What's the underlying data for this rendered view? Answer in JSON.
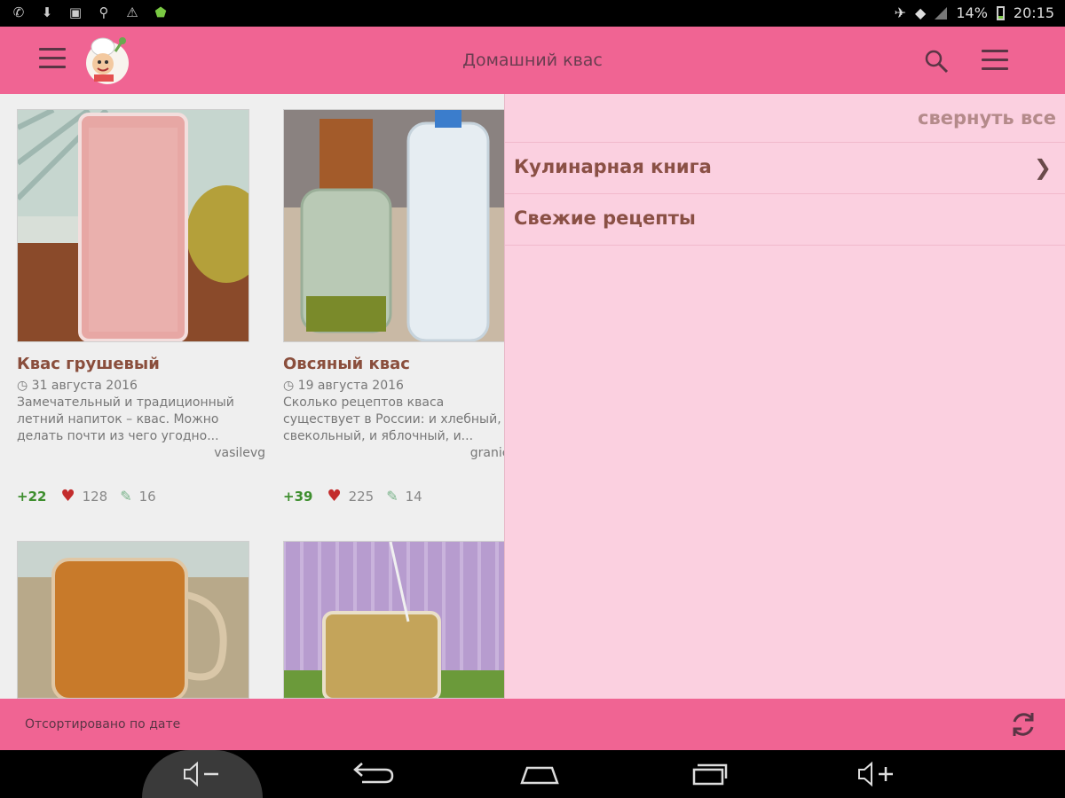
{
  "status_bar": {
    "left_icons": [
      "whatsapp-icon",
      "download-icon",
      "image-icon",
      "search-icon",
      "warning-icon",
      "shield-icon"
    ],
    "battery": "14%",
    "time": "20:15"
  },
  "app_bar": {
    "title": "Домашний квас",
    "colors": {
      "accent": "#f06493",
      "drawer": "#fbd0e0"
    }
  },
  "recipes": [
    {
      "title": "Квас грушевый",
      "date": "31 августа 2016",
      "description": "Замечательный и традиционный летний напиток – квас. Можно делать почти из чего угодно...",
      "author": "vasilevg",
      "score": "+22",
      "likes": "128",
      "comments": "16"
    },
    {
      "title": "Овсяный квас",
      "date": "19 августа 2016",
      "description": "Сколько рецептов кваса существует в России: и хлебный, и свекольный, и яблочный, и...",
      "author": "granichnil",
      "score": "+39",
      "likes": "225",
      "comments": "14"
    }
  ],
  "drawer": {
    "collapse_all": "свернуть все",
    "items": [
      {
        "label": "Кулинарная книга",
        "has_arrow": true
      },
      {
        "label": "Свежие рецепты",
        "has_arrow": false
      }
    ]
  },
  "bottom_bar": {
    "sort_label": "Отсортировано по дате"
  },
  "nav_bar": {
    "buttons": [
      "volume-down-icon",
      "back-icon",
      "home-icon",
      "recents-icon",
      "volume-up-icon"
    ]
  }
}
